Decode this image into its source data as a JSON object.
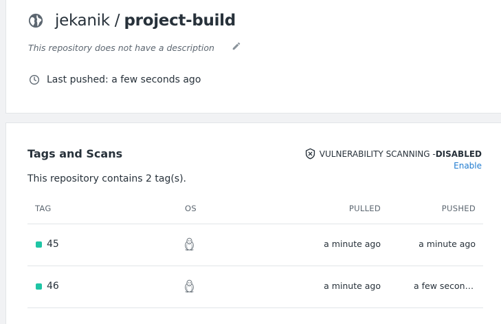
{
  "repo": {
    "owner": "jekanik",
    "separator": "/",
    "name": "project-build",
    "description": "This repository does not have a description",
    "last_pushed": "Last pushed: a few seconds ago"
  },
  "tags_section": {
    "title": "Tags and Scans",
    "count_text": "This repository contains 2 tag(s).",
    "vuln_label": "VULNERABILITY SCANNING - ",
    "vuln_status": "DISABLED",
    "enable_label": "Enable",
    "columns": {
      "tag": "TAG",
      "os": "OS",
      "pulled": "PULLED",
      "pushed": "PUSHED"
    },
    "rows": [
      {
        "tag": "45",
        "os_icon": "linux-tux-icon",
        "pulled": "a minute ago",
        "pushed": "a minute ago"
      },
      {
        "tag": "46",
        "os_icon": "linux-tux-icon",
        "pulled": "a minute ago",
        "pushed": "a few second..."
      }
    ]
  },
  "colors": {
    "accent": "#1f7bd0",
    "tag_dot": "#1fc5a5",
    "text": "#27313a",
    "muted": "#5c6670"
  }
}
